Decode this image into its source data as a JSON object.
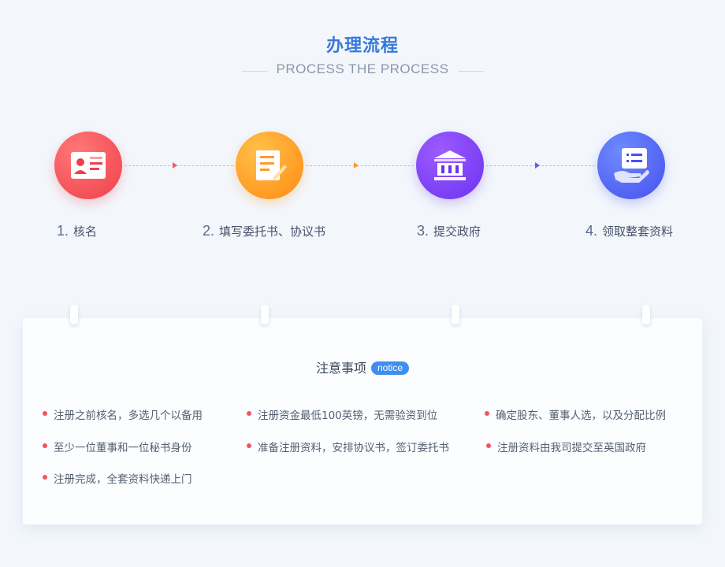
{
  "header": {
    "title": "办理流程",
    "subtitle": "PROCESS THE PROCESS"
  },
  "colors": {
    "accent": "#3a78d8",
    "step1": "#f03f4a",
    "step2": "#ff8a12",
    "step3": "#6a33f0",
    "step4": "#4650ee",
    "bullet": "#f0555a",
    "badge": "#3d8ef0"
  },
  "steps": [
    {
      "number": "1.",
      "label": "核名",
      "icon": "id-card-icon"
    },
    {
      "number": "2.",
      "label": "填写委托书、协议书",
      "icon": "document-pen-icon"
    },
    {
      "number": "3.",
      "label": "提交政府",
      "icon": "government-building-icon"
    },
    {
      "number": "4.",
      "label": "领取整套资料",
      "icon": "hand-receive-document-icon"
    }
  ],
  "notice": {
    "title": "注意事项",
    "badge": "notice",
    "items": [
      "注册之前核名，多选几个以备用",
      "注册资金最低100英镑，无需验资到位",
      "确定股东、董事人选，以及分配比例",
      "至少一位董事和一位秘书身份",
      "准备注册资料，安排协议书，签订委托书",
      "注册资料由我司提交至英国政府",
      "注册完成，全套资料快递上门"
    ]
  }
}
